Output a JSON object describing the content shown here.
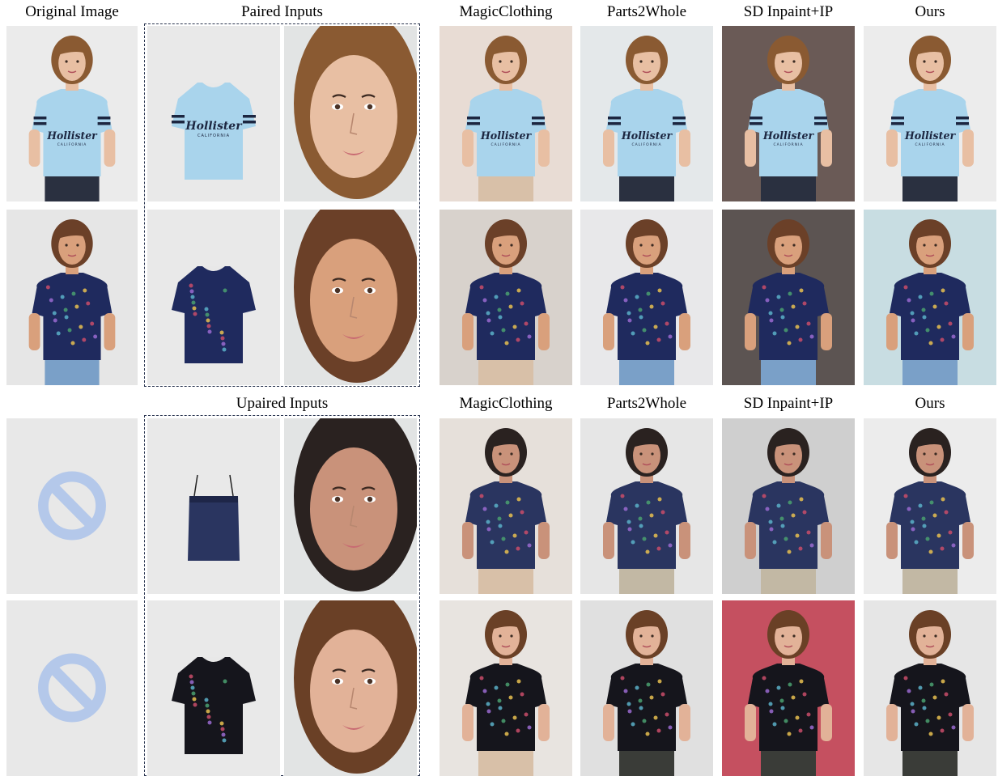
{
  "top_headers": {
    "original": "Original Image",
    "paired": "Paired Inputs",
    "magic": "MagicClothing",
    "parts": "Parts2Whole",
    "sd": "SD Inpaint+IP",
    "ours": "Ours"
  },
  "bottom_headers": {
    "unpaired": "Upaired Inputs",
    "magic": "MagicClothing",
    "parts": "Parts2Whole",
    "sd": "SD Inpaint+IP",
    "ours": "Ours"
  },
  "rows": [
    {
      "shirt": "#a9d4ec",
      "shirt_dark": "#8fbfdc",
      "hair": "#8a5a32",
      "skin": "#e8bfa3",
      "shirt_text": "Hollister",
      "shirt_subtext": "CALIFORNIA"
    },
    {
      "shirt": "#1f2a5e",
      "shirt_dark": "#172048",
      "hair": "#6b4028",
      "skin": "#d9a07c"
    },
    {
      "shirt": "#2a3560",
      "shirt_dark": "#1e2648",
      "hair": "#2a2220",
      "skin": "#c9927a"
    },
    {
      "shirt": "#15151c",
      "shirt_dark": "#0c0c12",
      "hair": "#6a4026",
      "skin": "#e2b298"
    }
  ],
  "colors": {
    "bg_light": "#e8e8e8",
    "bg_warm": "#ece4df",
    "bg_dark_grad": "#5c5452",
    "bg_red": "#c55060",
    "forbidden": "#b4c8ea"
  }
}
